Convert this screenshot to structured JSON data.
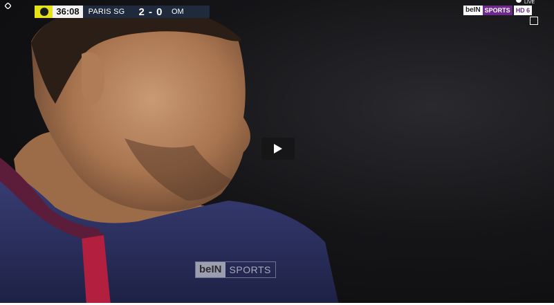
{
  "scorebug": {
    "time": "36:08",
    "home_team": "PARIS SG",
    "score": "2 - 0",
    "away_team": "OM"
  },
  "channel": {
    "bein": "beIN",
    "sports": "SPORTS",
    "hd": "HD 6",
    "live": "LIVE"
  },
  "watermark": {
    "bein": "beIN",
    "sports": "SPORTS"
  },
  "icons": {
    "play": "play-icon",
    "corner": "diamond-icon",
    "fullscreen": "square-icon"
  }
}
